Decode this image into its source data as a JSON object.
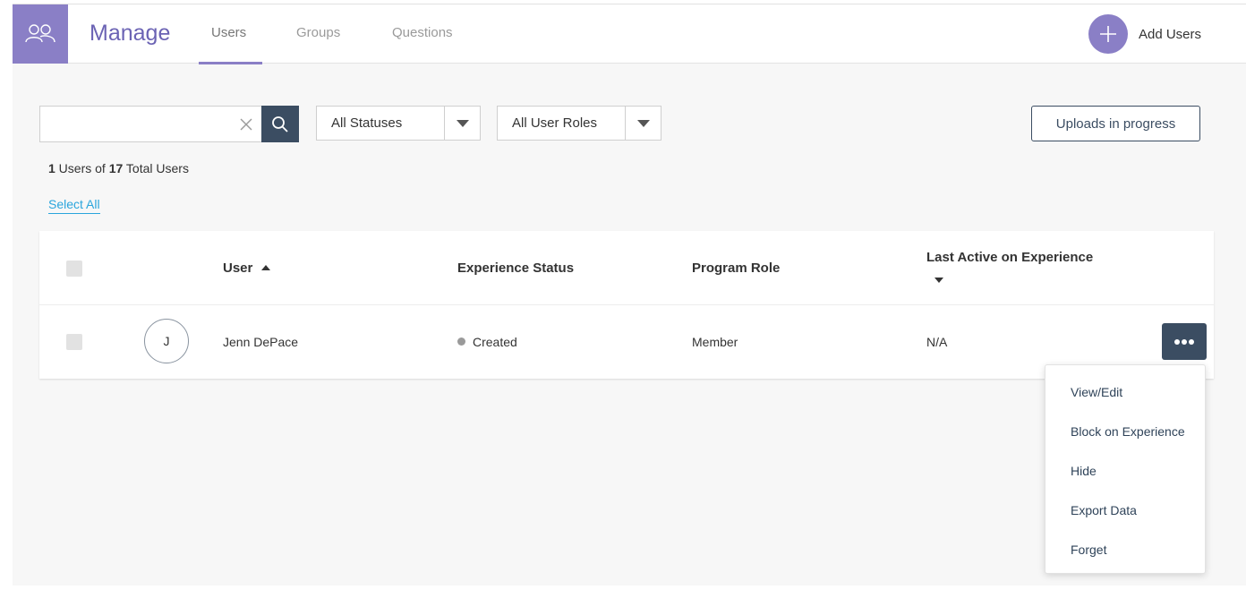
{
  "header": {
    "title": "Manage",
    "tabs": [
      {
        "label": "Users",
        "active": true
      },
      {
        "label": "Groups",
        "active": false
      },
      {
        "label": "Questions",
        "active": false
      }
    ],
    "add_users_label": "Add Users",
    "accent_color": "#8a7fc6"
  },
  "filters": {
    "search_value": "",
    "search_placeholder": "",
    "status_select": "All Statuses",
    "role_select": "All User Roles",
    "uploads_button": "Uploads in progress"
  },
  "summary": {
    "shown": "1",
    "shown_suffix": " Users of ",
    "total": "17",
    "total_suffix": " Total Users",
    "select_all": "Select All"
  },
  "table": {
    "columns": {
      "user": "User",
      "status": "Experience Status",
      "role": "Program Role",
      "last_active": "Last Active on Experience"
    },
    "rows": [
      {
        "initial": "J",
        "name": "Jenn DePace",
        "status": "Created",
        "role": "Member",
        "last_active": "N/A"
      }
    ]
  },
  "row_menu": {
    "items": [
      "View/Edit",
      "Block on Experience",
      "Hide",
      "Export Data",
      "Forget"
    ]
  },
  "icons": {
    "brand": "users-icon",
    "add": "plus-icon",
    "clear": "close-icon",
    "search": "search-icon",
    "more": "more-horizontal-icon"
  }
}
